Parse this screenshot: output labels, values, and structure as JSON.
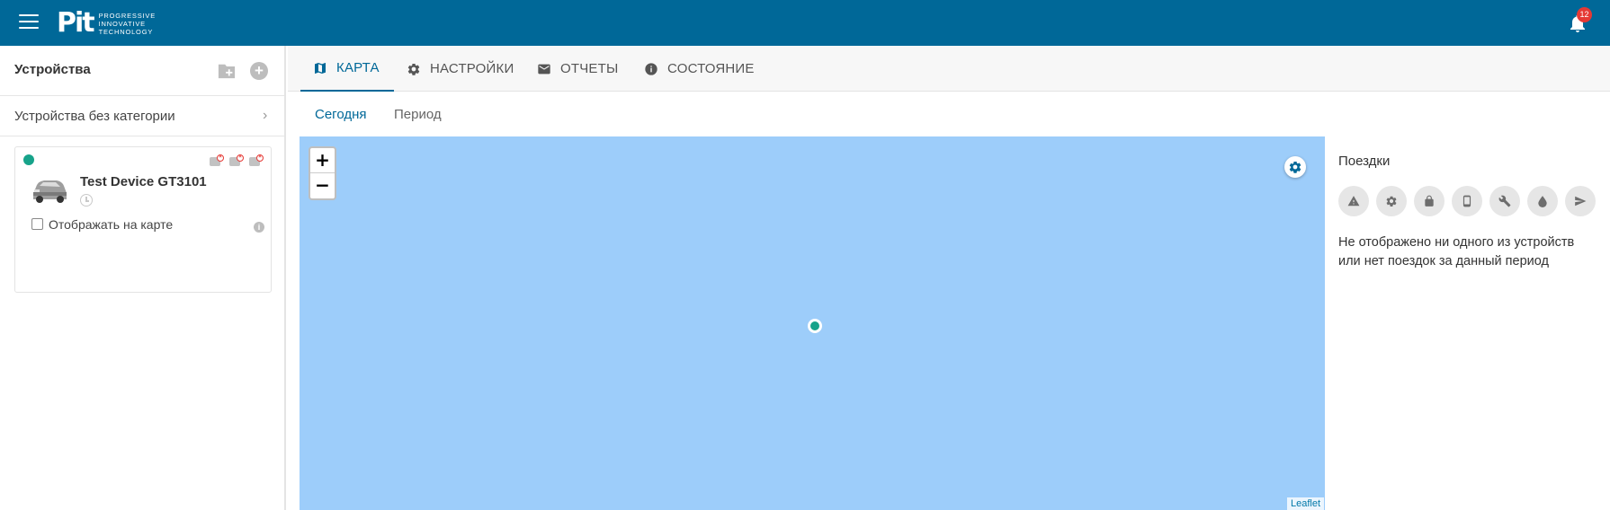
{
  "header": {
    "logo_mark": "Pit",
    "logo_line1": "PROGRESSIVE",
    "logo_line2": "INNOVATIVE",
    "logo_line3": "TECHNOLOGY",
    "notification_count": "12",
    "color": "#006898"
  },
  "sidebar": {
    "title": "Устройства",
    "category": "Устройства без категории",
    "device": {
      "name": "Test Device GT3101",
      "status_color": "#17a38a",
      "show_on_map_label": "Отображать на карте",
      "show_on_map_checked": false
    }
  },
  "tabs": [
    {
      "label": "КАРТА",
      "icon": "map-icon",
      "active": true
    },
    {
      "label": "НАСТРОЙКИ",
      "icon": "gear-icon",
      "active": false
    },
    {
      "label": "ОТЧЕТЫ",
      "icon": "mail-icon",
      "active": false
    },
    {
      "label": "СОСТОЯНИЕ",
      "icon": "info-icon",
      "active": false
    }
  ],
  "subtabs": [
    {
      "label": "Сегодня",
      "active": true
    },
    {
      "label": "Период",
      "active": false
    }
  ],
  "map": {
    "zoom_in": "+",
    "zoom_out": "−",
    "attribution": "Leaflet",
    "background_color": "#9dcdfa"
  },
  "trips": {
    "title": "Поездки",
    "filters": [
      "warning-icon",
      "gear-icon",
      "lock-icon",
      "phone-icon",
      "wrench-icon",
      "drop-icon",
      "send-icon"
    ],
    "empty_message": "Не отображено ни одного из устройств или нет поездок за данный период"
  }
}
